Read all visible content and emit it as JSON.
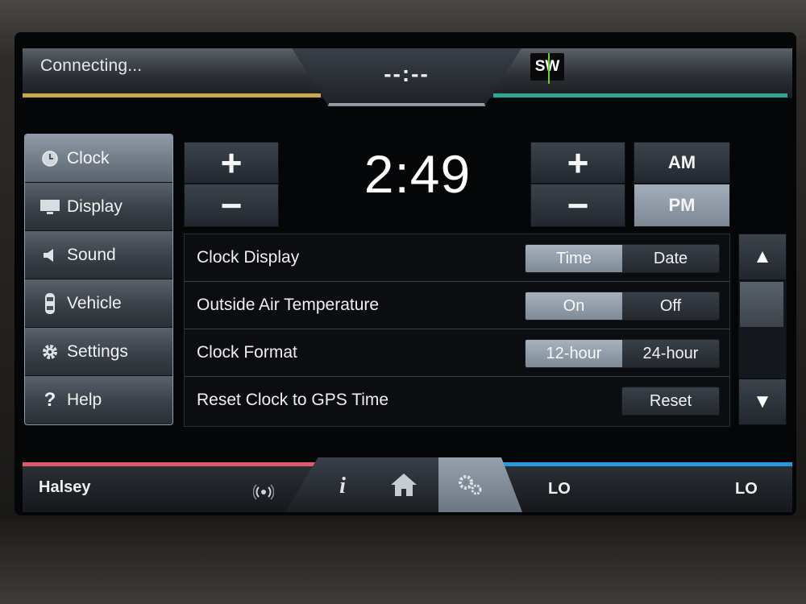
{
  "top_bar": {
    "status_text": "Connecting...",
    "center_clock": "--:--",
    "compass": "SW"
  },
  "sidebar": {
    "items": [
      {
        "label": "Clock",
        "icon": "clock-icon",
        "active": true
      },
      {
        "label": "Display",
        "icon": "display-icon",
        "active": false
      },
      {
        "label": "Sound",
        "icon": "speaker-icon",
        "active": false
      },
      {
        "label": "Vehicle",
        "icon": "car-icon",
        "active": false
      },
      {
        "label": "Settings",
        "icon": "gear-icon",
        "active": false
      },
      {
        "label": "Help",
        "icon": "help-icon",
        "active": false
      }
    ]
  },
  "clock": {
    "time": "2:49",
    "am_label": "AM",
    "pm_label": "PM",
    "selected_period": "PM",
    "plus_symbol": "+",
    "minus_symbol": "−"
  },
  "settings": {
    "rows": [
      {
        "label": "Clock Display",
        "options": [
          "Time",
          "Date"
        ],
        "selected": "Time"
      },
      {
        "label": "Outside Air Temperature",
        "options": [
          "On",
          "Off"
        ],
        "selected": "On"
      },
      {
        "label": "Clock Format",
        "options": [
          "12-hour",
          "24-hour"
        ],
        "selected": "12-hour"
      },
      {
        "label": "Reset Clock to GPS Time",
        "button": "Reset"
      }
    ]
  },
  "scroll": {
    "up_symbol": "▲",
    "down_symbol": "▼"
  },
  "bottom_bar": {
    "source": "Halsey",
    "left_temp": "LO",
    "right_temp": "LO",
    "info_symbol": "i"
  },
  "colors": {
    "top_left_accent": "#c9a94a",
    "top_right_accent": "#2fa88f",
    "bottom_left_accent": "#e05a6a",
    "bottom_right_accent": "#2a9ae0",
    "selected_button": "#8f9aa6"
  }
}
